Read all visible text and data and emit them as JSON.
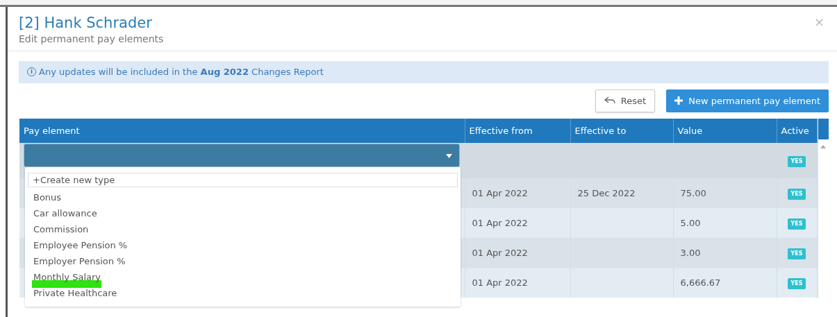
{
  "modal": {
    "title": "[2] Hank Schrader",
    "subtitle": "Edit permanent pay elements",
    "close": "×"
  },
  "notice": {
    "icon": "i",
    "text": "Any updates will be included in the **Aug 2022** Changes Report"
  },
  "buttons": [
    {
      "kind": "reset",
      "label": "Reset"
    },
    {
      "kind": "add",
      "label": "New permanent pay element"
    }
  ],
  "table": {
    "columns": [
      "Pay element",
      "Effective from",
      "Effective to",
      "Value",
      "Active"
    ],
    "edit_row": {
      "active": "YES"
    },
    "rows": [
      {
        "effective_from": "01 Apr 2022",
        "effective_to": "25 Dec 2022",
        "value": "75.00",
        "active": "YES"
      },
      {
        "effective_from": "01 Apr 2022",
        "value": "5.00",
        "active": "YES"
      },
      {
        "effective_from": "01 Apr 2022",
        "value": "3.00",
        "active": "YES"
      },
      {
        "effective_from": "01 Apr 2022",
        "value": "6,666.67",
        "active": "YES"
      }
    ]
  },
  "dropdown": {
    "expanded": true,
    "options": [
      {
        "label": "+Create new type",
        "kind": "create",
        "highlighted": false
      },
      {
        "label": "Bonus",
        "kind": "option",
        "highlighted": false
      },
      {
        "label": "Car allowance",
        "kind": "option",
        "highlighted": false
      },
      {
        "label": "Commission",
        "kind": "option",
        "highlighted": false
      },
      {
        "label": "Employee Pension %",
        "kind": "option",
        "highlighted": false
      },
      {
        "label": "Employer Pension %",
        "kind": "option",
        "highlighted": false
      },
      {
        "label": "Monthly Salary",
        "kind": "option",
        "highlighted": true
      },
      {
        "label": "Private Healthcare",
        "kind": "option",
        "highlighted": false
      }
    ]
  }
}
